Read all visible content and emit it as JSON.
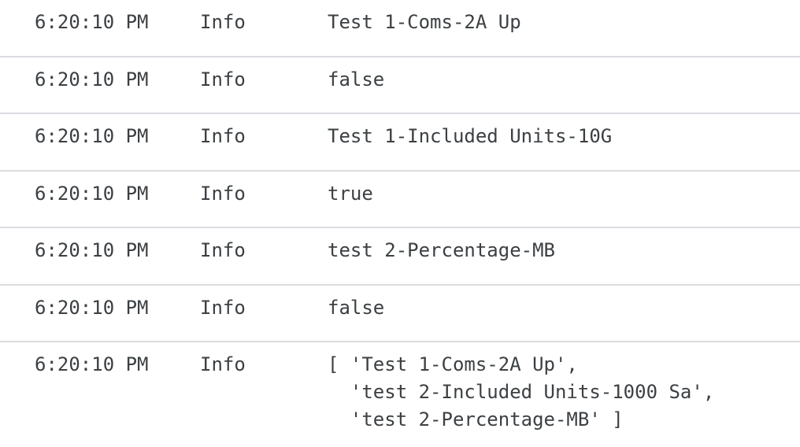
{
  "log": {
    "rows": [
      {
        "time": "6:20:10 PM",
        "level": "Info",
        "message": "Test 1-Coms-2A Up"
      },
      {
        "time": "6:20:10 PM",
        "level": "Info",
        "message": "false"
      },
      {
        "time": "6:20:10 PM",
        "level": "Info",
        "message": "Test 1-Included Units-10G"
      },
      {
        "time": "6:20:10 PM",
        "level": "Info",
        "message": "true"
      },
      {
        "time": "6:20:10 PM",
        "level": "Info",
        "message": "test 2-Percentage-MB"
      },
      {
        "time": "6:20:10 PM",
        "level": "Info",
        "message": "false"
      },
      {
        "time": "6:20:10 PM",
        "level": "Info",
        "message": "[ 'Test 1-Coms-2A Up',\n  'test 2-Included Units-1000 Sa',\n  'test 2-Percentage-MB' ]"
      }
    ]
  }
}
